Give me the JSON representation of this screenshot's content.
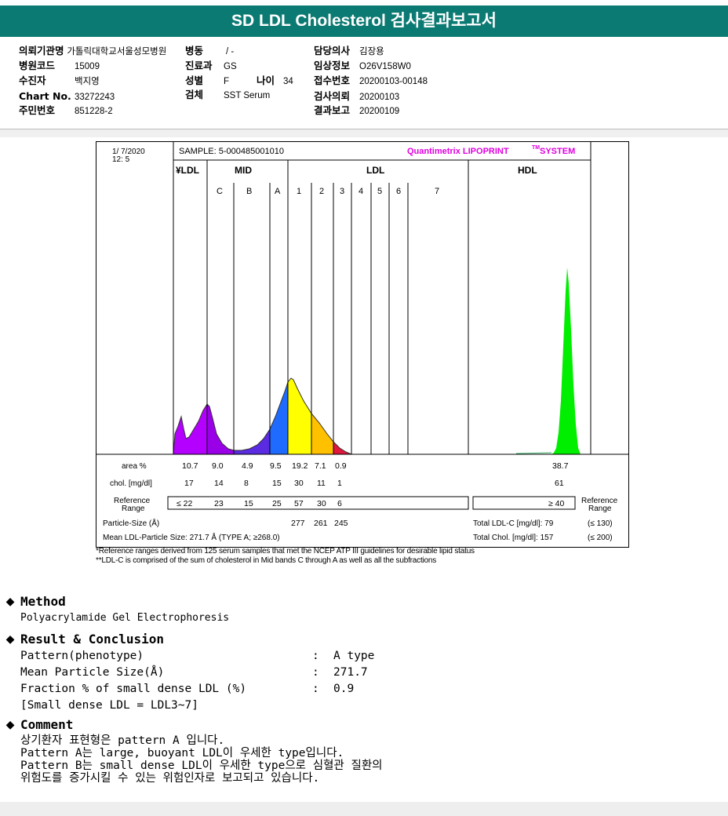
{
  "report": {
    "title": "SD LDL Cholesterol 검사결과보고서"
  },
  "info": {
    "left": [
      {
        "key": "의뢰기관명",
        "value": "가톨릭대학교서울성모병원"
      },
      {
        "key": "병원코드",
        "value": "15009"
      },
      {
        "key": "수진자",
        "value": "백지영"
      },
      {
        "key": "Chart No.",
        "value": "33272243"
      },
      {
        "key": "주민번호",
        "value": "851228-2"
      }
    ],
    "mid": [
      {
        "key": "병동",
        "value": "/ -"
      },
      {
        "key": "진료과",
        "value": "GS"
      },
      {
        "key": "성별",
        "value": "F"
      },
      {
        "key": "검체",
        "value": "SST Serum"
      }
    ],
    "age": {
      "key": "나이",
      "value": "34"
    },
    "right": [
      {
        "key": "담당의사",
        "value": "김장용"
      },
      {
        "key": "임상정보",
        "value": "O26V158W0"
      },
      {
        "key": "접수번호",
        "value": "20200103-00148"
      },
      {
        "key": "검사의뢰",
        "value": "20200103"
      },
      {
        "key": "결과보고",
        "value": "20200109"
      }
    ]
  },
  "chart_data": {
    "type": "area",
    "date": "1/ 7/2020",
    "time": "12: 5",
    "sample": "SAMPLE:   5-000485001010",
    "brand": "Quantimetrix LIPOPRINT",
    "brand_tm": "TM",
    "brand_suffix": "SYSTEM",
    "groups": [
      "VLDL",
      "MID",
      "LDL",
      "HDL"
    ],
    "bands": [
      "C",
      "B",
      "A",
      "1",
      "2",
      "3",
      "4",
      "5",
      "6",
      "7"
    ],
    "band_colors": {
      "VLDL": "#b400ff",
      "C": "#9a00e8",
      "B": "#5a2be0",
      "A": "#1f6bff",
      "1": "#ffff00",
      "2": "#ffc000",
      "3": "#e0183c",
      "HDL": "#00ee00"
    },
    "row_labels": {
      "area": "area %",
      "chol": "chol. [mg/dl]",
      "ref": "Reference Range",
      "ref_right": "Reference Range",
      "ps": "Particle-Size (Å)"
    },
    "area_percent": [
      {
        "band": "VLDL",
        "value": "10.7"
      },
      {
        "band": "C",
        "value": "9.0"
      },
      {
        "band": "B",
        "value": "4.9"
      },
      {
        "band": "A",
        "value": "9.5"
      },
      {
        "band": "1",
        "value": "19.2"
      },
      {
        "band": "2",
        "value": "7.1"
      },
      {
        "band": "3",
        "value": "0.9"
      },
      {
        "band": "HDL",
        "value": "38.7"
      }
    ],
    "chol_mg_dl": [
      {
        "band": "VLDL",
        "value": "17"
      },
      {
        "band": "C",
        "value": "14"
      },
      {
        "band": "B",
        "value": "8"
      },
      {
        "band": "A",
        "value": "15"
      },
      {
        "band": "1",
        "value": "30"
      },
      {
        "band": "2",
        "value": "11"
      },
      {
        "band": "3",
        "value": "1"
      },
      {
        "band": "HDL",
        "value": "61"
      }
    ],
    "reference_range": [
      {
        "band": "VLDL",
        "value": "≤ 22"
      },
      {
        "band": "C",
        "value": "23"
      },
      {
        "band": "B",
        "value": "15"
      },
      {
        "band": "A",
        "value": "25"
      },
      {
        "band": "1",
        "value": "57"
      },
      {
        "band": "2",
        "value": "30"
      },
      {
        "band": "3",
        "value": "6"
      },
      {
        "band": "HDL",
        "value": "≥ 40"
      }
    ],
    "particle_size": [
      {
        "band": "1",
        "value": "277"
      },
      {
        "band": "2",
        "value": "261"
      },
      {
        "band": "3",
        "value": "245"
      }
    ],
    "total_ldl_c": {
      "label": "Total LDL-C [mg/dl]:",
      "value": "79",
      "ref": "(≤ 130)"
    },
    "total_chol": {
      "label": "Total Chol. [mg/dl]:",
      "value": "157",
      "ref": "(≤ 200)"
    },
    "mean_ldl_particle": {
      "label": "Mean LDL-Particle Size:",
      "value": "271.7 Å",
      "type": "(TYPE A; ≥268.0)"
    }
  },
  "footnotes": [
    "*Reference ranges derived from 125 serum samples that met the NCEP ATP III guidelines for desirable lipid status",
    "**LDL-C is comprised of the sum of cholesterol in Mid bands C through A as well as all the subfractions"
  ],
  "method": {
    "heading": "Method",
    "text": "Polyacrylamide Gel Electrophoresis"
  },
  "result": {
    "heading": "Result & Conclusion",
    "rows": [
      {
        "label": "Pattern(phenotype)",
        "value": "A type"
      },
      {
        "label": "Mean Particle Size(Å)",
        "value": "271.7"
      },
      {
        "label": "Fraction % of small dense LDL (%)",
        "value": "0.9"
      }
    ],
    "note": "[Small dense LDL = LDL3~7]",
    "sep": ":"
  },
  "comment": {
    "heading": "Comment",
    "lines": [
      "상기환자 표현형은 pattern A 입니다.",
      "Pattern A는 large, buoyant LDL이 우세한 type입니다.",
      "Pattern B는 small dense LDL이 우세한 type으로 심혈관 질환의",
      "위험도를 증가시킬 수 있는 위험인자로 보고되고 있습니다."
    ]
  }
}
